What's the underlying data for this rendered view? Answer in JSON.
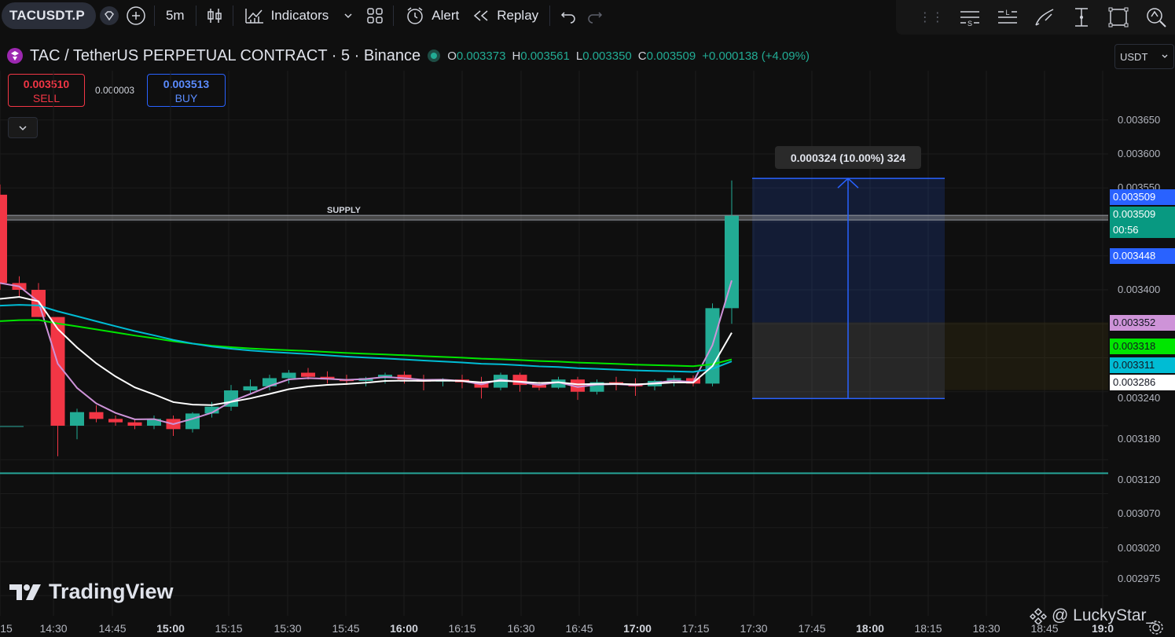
{
  "toolbar": {
    "symbol": "TACUSDT.P",
    "interval": "5m",
    "indicators_label": "Indicators",
    "alert_label": "Alert",
    "replay_label": "Replay"
  },
  "legend": {
    "title": "TAC / TetherUS PERPETUAL CONTRACT · 5 · Binance",
    "o_label": "O",
    "o_value": "0.003373",
    "h_label": "H",
    "h_value": "0.003561",
    "l_label": "L",
    "l_value": "0.003350",
    "c_label": "C",
    "c_value": "0.003509",
    "change": "+0.000138 (+4.09%)"
  },
  "trade": {
    "sell_price": "0.003510",
    "sell_label": "SELL",
    "spread": "0.000003",
    "buy_price": "0.003513",
    "buy_label": "BUY"
  },
  "currency": "USDT",
  "price_axis": {
    "ticks": [
      "0.003650",
      "0.003600",
      "0.003550",
      "0.003400",
      "0.003240",
      "0.003180",
      "0.003120",
      "0.003070",
      "0.003020",
      "0.002975"
    ],
    "tags": [
      {
        "text": "0.003509",
        "bg": "#2962ff",
        "color": "#ffffff"
      },
      {
        "text": "0.003509",
        "bg": "#089981",
        "color": "#ffffff"
      },
      {
        "text": "00:56",
        "bg": "#089981",
        "color": "#ffffff"
      },
      {
        "text": "0.003448",
        "bg": "#2962ff",
        "color": "#ffffff"
      },
      {
        "text": "0.003352",
        "bg": "#ce93d8",
        "color": "#131722"
      },
      {
        "text": "0.003318",
        "bg": "#00e600",
        "color": "#131722"
      },
      {
        "text": "0.003311",
        "bg": "#00bcd4",
        "color": "#131722"
      },
      {
        "text": "0.003286",
        "bg": "#ffffff",
        "color": "#131722"
      }
    ]
  },
  "time_axis": {
    "ticks": [
      {
        "label": "15",
        "bold": false
      },
      {
        "label": "14:30",
        "bold": false
      },
      {
        "label": "14:45",
        "bold": false
      },
      {
        "label": "15:00",
        "bold": true
      },
      {
        "label": "15:15",
        "bold": false
      },
      {
        "label": "15:30",
        "bold": false
      },
      {
        "label": "15:45",
        "bold": false
      },
      {
        "label": "16:00",
        "bold": true
      },
      {
        "label": "16:15",
        "bold": false
      },
      {
        "label": "16:30",
        "bold": false
      },
      {
        "label": "16:45",
        "bold": false
      },
      {
        "label": "17:00",
        "bold": true
      },
      {
        "label": "17:15",
        "bold": false
      },
      {
        "label": "17:30",
        "bold": false
      },
      {
        "label": "17:45",
        "bold": false
      },
      {
        "label": "18:00",
        "bold": true
      },
      {
        "label": "18:15",
        "bold": false
      },
      {
        "label": "18:30",
        "bold": false
      },
      {
        "label": "18:45",
        "bold": false
      },
      {
        "label": "19:0",
        "bold": true
      }
    ]
  },
  "drawings": {
    "supply_label": "SUPPLY",
    "measure_label": "0.000324 (10.00%) 324"
  },
  "branding": {
    "logo_text": "TradingView",
    "user_watermark": "@ LuckyStar_"
  },
  "colors": {
    "up": "#22ab94",
    "down": "#f23645",
    "accent_blue": "#2962ff"
  },
  "chart_data": {
    "type": "candlestick",
    "candles": [
      {
        "o": 0.00354,
        "h": 0.003555,
        "l": 0.0034,
        "c": 0.00341
      },
      {
        "o": 0.00341,
        "h": 0.00342,
        "l": 0.00339,
        "c": 0.0034
      },
      {
        "o": 0.0034,
        "h": 0.00341,
        "l": 0.00336,
        "c": 0.00336
      },
      {
        "o": 0.00336,
        "h": 0.00336,
        "l": 0.003155,
        "c": 0.0032
      },
      {
        "o": 0.0032,
        "h": 0.003225,
        "l": 0.00318,
        "c": 0.00322
      },
      {
        "o": 0.00322,
        "h": 0.00323,
        "l": 0.003205,
        "c": 0.00321
      },
      {
        "o": 0.00321,
        "h": 0.003215,
        "l": 0.0032,
        "c": 0.003205
      },
      {
        "o": 0.003205,
        "h": 0.00321,
        "l": 0.003195,
        "c": 0.0032
      },
      {
        "o": 0.0032,
        "h": 0.003215,
        "l": 0.003195,
        "c": 0.00321
      },
      {
        "o": 0.00321,
        "h": 0.003215,
        "l": 0.003185,
        "c": 0.003195
      },
      {
        "o": 0.003195,
        "h": 0.00322,
        "l": 0.00319,
        "c": 0.003218
      },
      {
        "o": 0.003218,
        "h": 0.003235,
        "l": 0.003212,
        "c": 0.003228
      },
      {
        "o": 0.003228,
        "h": 0.00326,
        "l": 0.003222,
        "c": 0.003252
      },
      {
        "o": 0.003252,
        "h": 0.003268,
        "l": 0.003248,
        "c": 0.003258
      },
      {
        "o": 0.003258,
        "h": 0.003275,
        "l": 0.003252,
        "c": 0.00327
      },
      {
        "o": 0.00327,
        "h": 0.003282,
        "l": 0.003262,
        "c": 0.003278
      },
      {
        "o": 0.003278,
        "h": 0.003285,
        "l": 0.003268,
        "c": 0.003272
      },
      {
        "o": 0.003272,
        "h": 0.00328,
        "l": 0.003262,
        "c": 0.003268
      },
      {
        "o": 0.003268,
        "h": 0.003275,
        "l": 0.00326,
        "c": 0.003266
      },
      {
        "o": 0.003266,
        "h": 0.003272,
        "l": 0.003258,
        "c": 0.00327
      },
      {
        "o": 0.00327,
        "h": 0.003278,
        "l": 0.003262,
        "c": 0.003275
      },
      {
        "o": 0.003275,
        "h": 0.00328,
        "l": 0.003262,
        "c": 0.003268
      },
      {
        "o": 0.003268,
        "h": 0.003275,
        "l": 0.003252,
        "c": 0.003265
      },
      {
        "o": 0.003265,
        "h": 0.00327,
        "l": 0.003258,
        "c": 0.003268
      },
      {
        "o": 0.003268,
        "h": 0.003275,
        "l": 0.003255,
        "c": 0.003264
      },
      {
        "o": 0.003264,
        "h": 0.003272,
        "l": 0.00324,
        "c": 0.003256
      },
      {
        "o": 0.003256,
        "h": 0.003278,
        "l": 0.003252,
        "c": 0.003275
      },
      {
        "o": 0.003275,
        "h": 0.003278,
        "l": 0.00325,
        "c": 0.00326
      },
      {
        "o": 0.00326,
        "h": 0.003265,
        "l": 0.003252,
        "c": 0.003256
      },
      {
        "o": 0.003256,
        "h": 0.003272,
        "l": 0.003254,
        "c": 0.003268
      },
      {
        "o": 0.003268,
        "h": 0.003272,
        "l": 0.003238,
        "c": 0.00325
      },
      {
        "o": 0.00325,
        "h": 0.003268,
        "l": 0.003246,
        "c": 0.003264
      },
      {
        "o": 0.003264,
        "h": 0.003272,
        "l": 0.003252,
        "c": 0.003262
      },
      {
        "o": 0.003262,
        "h": 0.00327,
        "l": 0.003244,
        "c": 0.003258
      },
      {
        "o": 0.003258,
        "h": 0.003268,
        "l": 0.003252,
        "c": 0.003266
      },
      {
        "o": 0.003266,
        "h": 0.003274,
        "l": 0.003258,
        "c": 0.00327
      },
      {
        "o": 0.00327,
        "h": 0.003274,
        "l": 0.003258,
        "c": 0.003262
      },
      {
        "o": 0.003262,
        "h": 0.00338,
        "l": 0.003258,
        "c": 0.003373
      },
      {
        "o": 0.003373,
        "h": 0.003561,
        "l": 0.00335,
        "c": 0.003509
      }
    ],
    "ema_lines": [
      {
        "color": "#ce93d8",
        "last": 0.003352
      },
      {
        "color": "#00e600",
        "last": 0.003318
      },
      {
        "color": "#00bcd4",
        "last": 0.003311
      },
      {
        "color": "#ffffff",
        "last": 0.003286
      }
    ],
    "levels": {
      "supply": 0.003505,
      "support": 0.00313
    },
    "measurement": {
      "from": 0.00324,
      "to": 0.003564,
      "change": 0.000324,
      "pct": 10.0,
      "bars": 324
    },
    "long_position_zone": {
      "entry": 0.003352,
      "target": 0.003564,
      "stop": 0.00324
    }
  }
}
